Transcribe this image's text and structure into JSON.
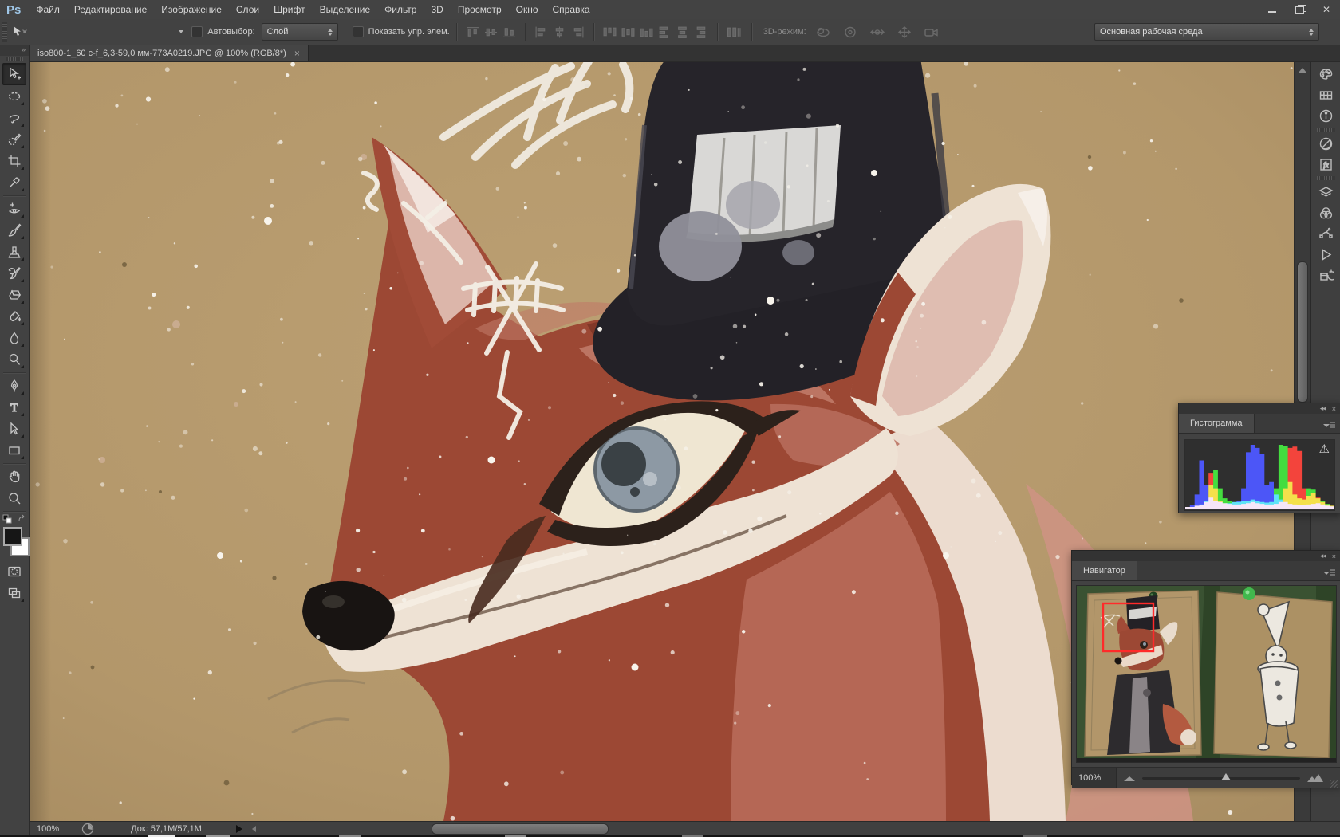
{
  "menu_bar": {
    "logo": "Ps",
    "items": [
      "Файл",
      "Редактирование",
      "Изображение",
      "Слои",
      "Шрифт",
      "Выделение",
      "Фильтр",
      "3D",
      "Просмотр",
      "Окно",
      "Справка"
    ]
  },
  "options_bar": {
    "autoselect_label": "Автовыбор:",
    "autoselect_value": "Слой",
    "show_controls_label": "Показать упр. элем.",
    "mode_3d_label": "3D-режим:",
    "workspace": "Основная рабочая среда"
  },
  "document_tab": {
    "title": "iso800-1_60 c-f_6,3-59,0 мм-773A0219.JPG @ 100% (RGB/8*)",
    "close_glyph": "×"
  },
  "toolbar": {
    "collapse_glyph": "»",
    "tools": [
      "move",
      "elliptical-marquee",
      "lasso",
      "quick-selection",
      "crop",
      "eyedropper",
      "healing",
      "brush",
      "clone-stamp",
      "history-brush",
      "eraser",
      "paint-bucket",
      "blur",
      "dodge",
      "pen",
      "type",
      "path-selection",
      "rectangle",
      "hand",
      "zoom"
    ],
    "foreground_color": "#161616",
    "background_color": "#ffffff"
  },
  "right_dock": {
    "collapse_glyph": "◂◂",
    "icons": [
      "color",
      "swatches",
      "info",
      "adjustments",
      "styles",
      "layers",
      "channels",
      "paths",
      "actions",
      "history"
    ]
  },
  "histogram_panel": {
    "title": "Гистограмма",
    "collapse_glyph": "◂◂",
    "close_glyph": "×",
    "warning_glyph": "⚠",
    "chart": {
      "type": "histogram-rgb",
      "bins": 32,
      "series": [
        {
          "name": "red",
          "color": "#f01a10",
          "values": [
            0,
            0,
            2,
            3,
            8,
            55,
            30,
            10,
            6,
            5,
            4,
            4,
            5,
            6,
            8,
            6,
            5,
            4,
            4,
            5,
            8,
            30,
            95,
            97,
            90,
            30,
            18,
            22,
            15,
            8,
            4,
            2
          ]
        },
        {
          "name": "green",
          "color": "#1ad514",
          "values": [
            0,
            0,
            2,
            4,
            10,
            35,
            60,
            30,
            14,
            10,
            8,
            8,
            9,
            10,
            12,
            10,
            8,
            7,
            8,
            30,
            100,
            98,
            40,
            20,
            14,
            12,
            30,
            28,
            14,
            10,
            5,
            2
          ]
        },
        {
          "name": "blue",
          "color": "#2430f5",
          "values": [
            0,
            3,
            20,
            75,
            35,
            15,
            10,
            8,
            6,
            6,
            8,
            10,
            30,
            88,
            100,
            95,
            85,
            35,
            40,
            20,
            12,
            8,
            5,
            4,
            3,
            3,
            4,
            5,
            6,
            4,
            2,
            1
          ]
        }
      ]
    }
  },
  "navigator_panel": {
    "title": "Навигатор",
    "collapse_glyph": "◂◂",
    "close_glyph": "×",
    "zoom_value": "100%"
  },
  "status_bar": {
    "zoom": "100%",
    "doc_label": "Док: 57,1М/57,1М"
  },
  "canvas": {
    "description": "Watercolor painting of a red fox wearing a black top hat on kraft paper, spattered with white snow dots",
    "colors": {
      "paper": "#b69a6c",
      "fox_red": "#9c4834",
      "fox_red_light": "#c07a68",
      "fox_shadow": "#7b3425",
      "white_fur": "#eee2d4",
      "chest_white": "#ecdccf",
      "hat_black": "#26242a",
      "hat_brim": "#232127",
      "hat_band": "#d9d8d6",
      "nose_black": "#181412",
      "eye_iris": "#8d99a4",
      "eye_pupil": "#3a4145",
      "ear_inner": "#dcb6aa"
    },
    "snow": {
      "count": 250,
      "color": "#f6f2ea"
    }
  }
}
